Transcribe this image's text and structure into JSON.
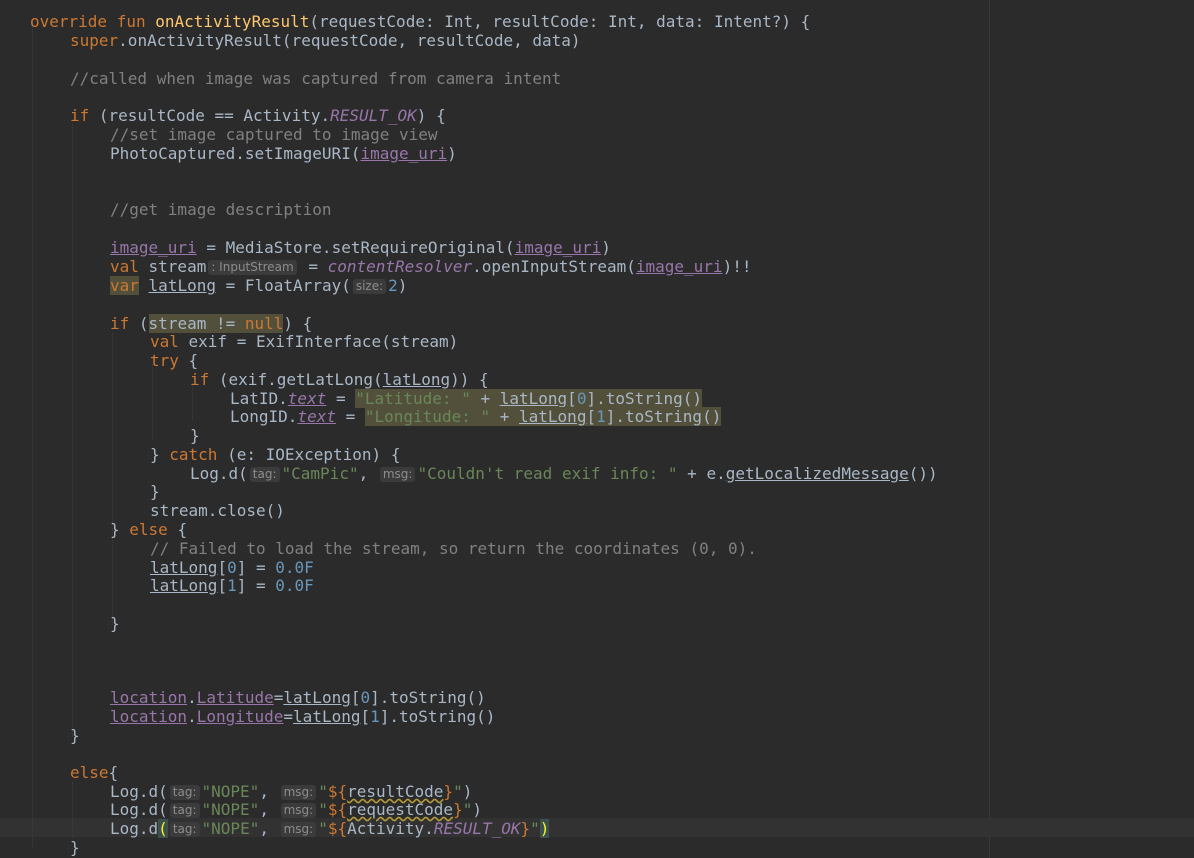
{
  "editor": {
    "lines": {
      "l1": [
        "override fun ",
        "onActivityResult",
        "(requestCode: Int, resultCode: Int, data: Intent?) {"
      ],
      "l2": [
        "super",
        ".onActivityResult(requestCode, resultCode, data)"
      ],
      "l4": [
        "//called when image was captured from camera intent"
      ],
      "l6": [
        "if ",
        "(resultCode == Activity.",
        "RESULT_OK",
        ") {"
      ],
      "l7": [
        "//set image captured to image view"
      ],
      "l8": [
        "PhotoCaptured.setImageURI(",
        "image_uri",
        ")"
      ],
      "l11": [
        "//get image description"
      ],
      "l13": [
        "image_uri",
        " = MediaStore.setRequireOriginal(",
        "image_uri",
        ")"
      ],
      "l14": [
        "val ",
        "stream",
        ": InputStream",
        " = ",
        "contentResolver",
        ".openInputStream(",
        "image_uri",
        ")!!"
      ],
      "l15": [
        "var",
        " ",
        "latLong",
        " = FloatArray(",
        "size:",
        "2",
        ")"
      ],
      "l17": [
        "if ",
        "(",
        "stream != ",
        "null",
        ") {"
      ],
      "l18": [
        "val ",
        "exif = ExifInterface(stream)"
      ],
      "l19": [
        "try ",
        "{"
      ],
      "l20": [
        "if ",
        "(exif.getLatLong(",
        "latLong",
        ")) {"
      ],
      "l21": [
        "LatID.",
        "text",
        " = ",
        "\"Latitude: \"",
        " + ",
        "latLong",
        "[",
        "0",
        "].toString()"
      ],
      "l22": [
        "LongID.",
        "text",
        " = ",
        "\"Longitude: \"",
        " + ",
        "latLong",
        "[",
        "1",
        "].toString()"
      ],
      "l23": [
        "}"
      ],
      "l24": [
        "} ",
        "catch ",
        "(e: IOException) {"
      ],
      "l25": [
        "Log.d(",
        "tag:",
        "\"CamPic\"",
        ", ",
        "msg:",
        "\"Couldn't read exif info: \"",
        " + e.",
        "getLocalizedMessage",
        "())"
      ],
      "l26": [
        "}"
      ],
      "l27": [
        "stream.close()"
      ],
      "l28": [
        "} ",
        "else ",
        "{"
      ],
      "l29": [
        "// Failed to load the stream, so return the coordinates (0, 0)."
      ],
      "l30": [
        "latLong",
        "[",
        "0",
        "] = ",
        "0.0F"
      ],
      "l31": [
        "latLong",
        "[",
        "1",
        "] = ",
        "0.0F"
      ],
      "l33": [
        "}"
      ],
      "l37": [
        "location",
        ".",
        "Latitude",
        "=",
        "latLong",
        "[",
        "0",
        "].toString()"
      ],
      "l38": [
        "location",
        ".",
        "Longitude",
        "=",
        "latLong",
        "[",
        "1",
        "].toString()"
      ],
      "l39": [
        "}"
      ],
      "l41": [
        "else",
        "{"
      ],
      "l42": [
        "Log.d(",
        "tag:",
        "\"NOPE\"",
        ", ",
        "msg:",
        "\"",
        "${",
        "resultCode",
        "}",
        "\"",
        ")"
      ],
      "l43": [
        "Log.d(",
        "tag:",
        "\"NOPE\"",
        ", ",
        "msg:",
        "\"",
        "${",
        "requestCode",
        "}",
        "\"",
        ")"
      ],
      "l44": [
        "Log.d",
        "(",
        "tag:",
        "\"NOPE\"",
        ", ",
        "msg:",
        "\"",
        "${",
        "Activity.",
        "RESULT_OK",
        "}",
        "\"",
        ")"
      ],
      "l45": [
        "}"
      ]
    }
  }
}
